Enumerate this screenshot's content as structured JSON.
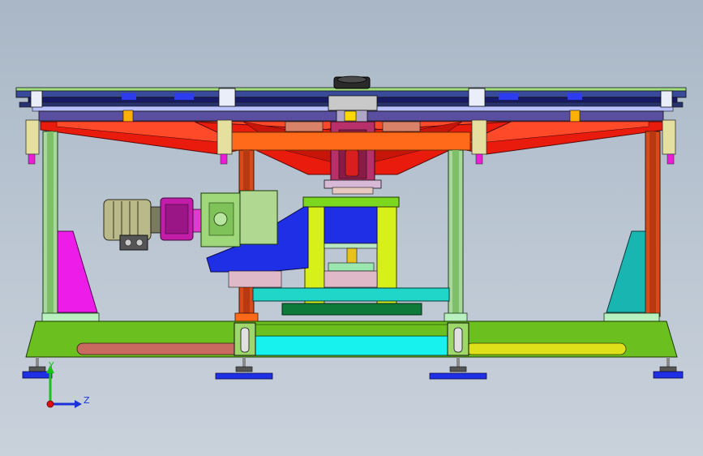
{
  "viewport": {
    "background_top": "#a9b7c6",
    "background_bottom": "#c9d1db"
  },
  "triad": {
    "y_label": "Y",
    "z_label": "Z",
    "y_color": "#19c219",
    "z_color": "#1a33d6",
    "x_color": "#e01010"
  },
  "assembly": {
    "parts": [
      "top-frame",
      "gear-motor",
      "red-strut-arms",
      "center-spindle",
      "blue-fixture",
      "green-base-plate",
      "leveling-feet",
      "side-gussets"
    ],
    "colors": {
      "base": "#6bbf1e",
      "strut": "#e81b0c",
      "beam": "#ff6a1a",
      "fixture_blue": "#1f2fe6",
      "motor_magenta": "#c21ca8",
      "motor_gray": "#b9b98a",
      "gusset_left": "#ee1ce8",
      "gusset_right": "#19b5b0",
      "cyan": "#18f2ee",
      "yellow": "#e0e01a"
    }
  }
}
